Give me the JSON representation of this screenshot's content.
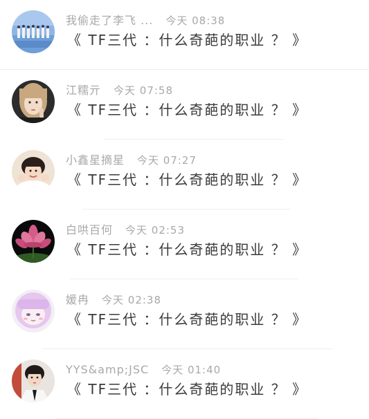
{
  "comments": [
    {
      "avatar": "landscape-group-avatar",
      "name": "我偷走了李飞 ...",
      "time": "今天 08:38",
      "text": "《 TF三代 ：什么奇葩的职业 ？ 》"
    },
    {
      "avatar": "girl-portrait-avatar",
      "name": "江糯亓",
      "time": "今天 07:58",
      "text": "《 TF三代 ：什么奇葩的职业 ？ 》"
    },
    {
      "avatar": "boy-portrait-avatar",
      "name": "小鑫星摘星",
      "time": "今天 07:27",
      "text": "《 TF三代 ：什么奇葩的职业 ？ 》"
    },
    {
      "avatar": "lotus-flower-avatar",
      "name": "白哄百何",
      "time": "今天 02:53",
      "text": "《 TF三代 ：什么奇葩的职业 ？ 》"
    },
    {
      "avatar": "anime-girl-avatar",
      "name": "媛冉",
      "time": "今天 02:38",
      "text": "《 TF三代 ：什么奇葩的职业 ？ 》"
    },
    {
      "avatar": "young-man-avatar",
      "name": "YYS&amp;JSC",
      "time": "今天 01:40",
      "text": "《 TF三代 ：什么奇葩的职业 ？ 》"
    }
  ]
}
